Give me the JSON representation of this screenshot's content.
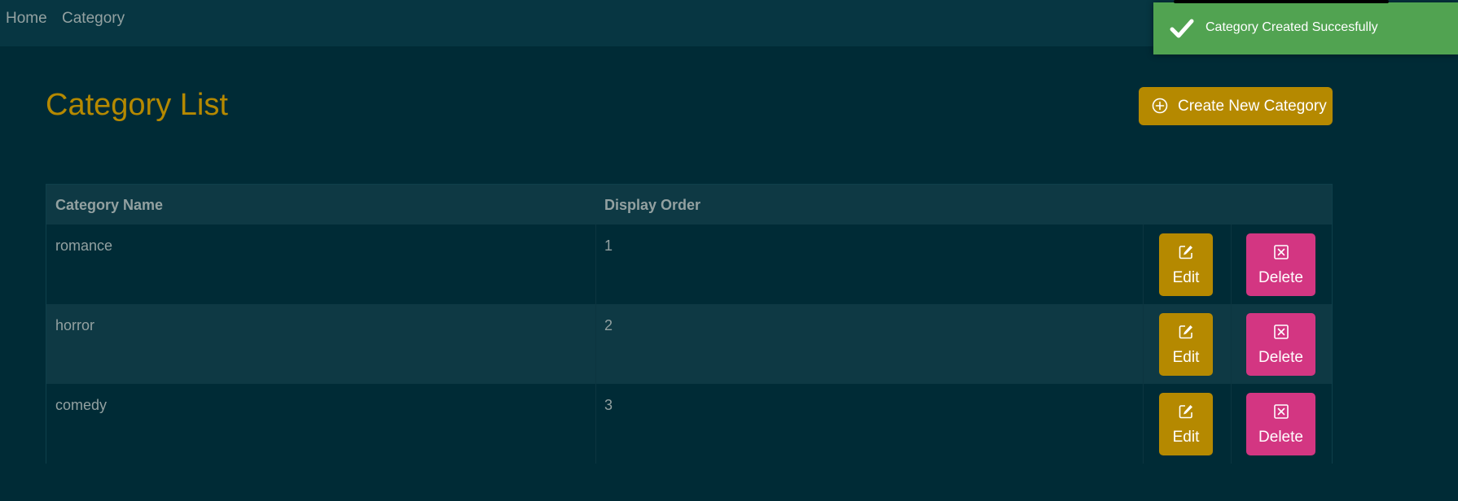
{
  "nav": {
    "home_label": "Home",
    "category_label": "Category"
  },
  "toast": {
    "message": "Category Created Succesfully",
    "icon": "checkmark-icon",
    "color": "#51a351"
  },
  "page": {
    "title": "Category List",
    "create_button_label": "Create New Category",
    "create_button_icon": "plus-circle-icon"
  },
  "table": {
    "columns": [
      "Category Name",
      "Display Order"
    ],
    "rows": [
      {
        "name": "romance",
        "order": "1",
        "edit_label": "Edit",
        "delete_label": "Delete"
      },
      {
        "name": "horror",
        "order": "2",
        "edit_label": "Edit",
        "delete_label": "Delete"
      },
      {
        "name": "comedy",
        "order": "3",
        "edit_label": "Edit",
        "delete_label": "Delete"
      }
    ]
  },
  "colors": {
    "background": "#002b36",
    "navbar": "#073642",
    "accent": "#b58900",
    "danger": "#d33682",
    "text": "#93a1a1"
  }
}
